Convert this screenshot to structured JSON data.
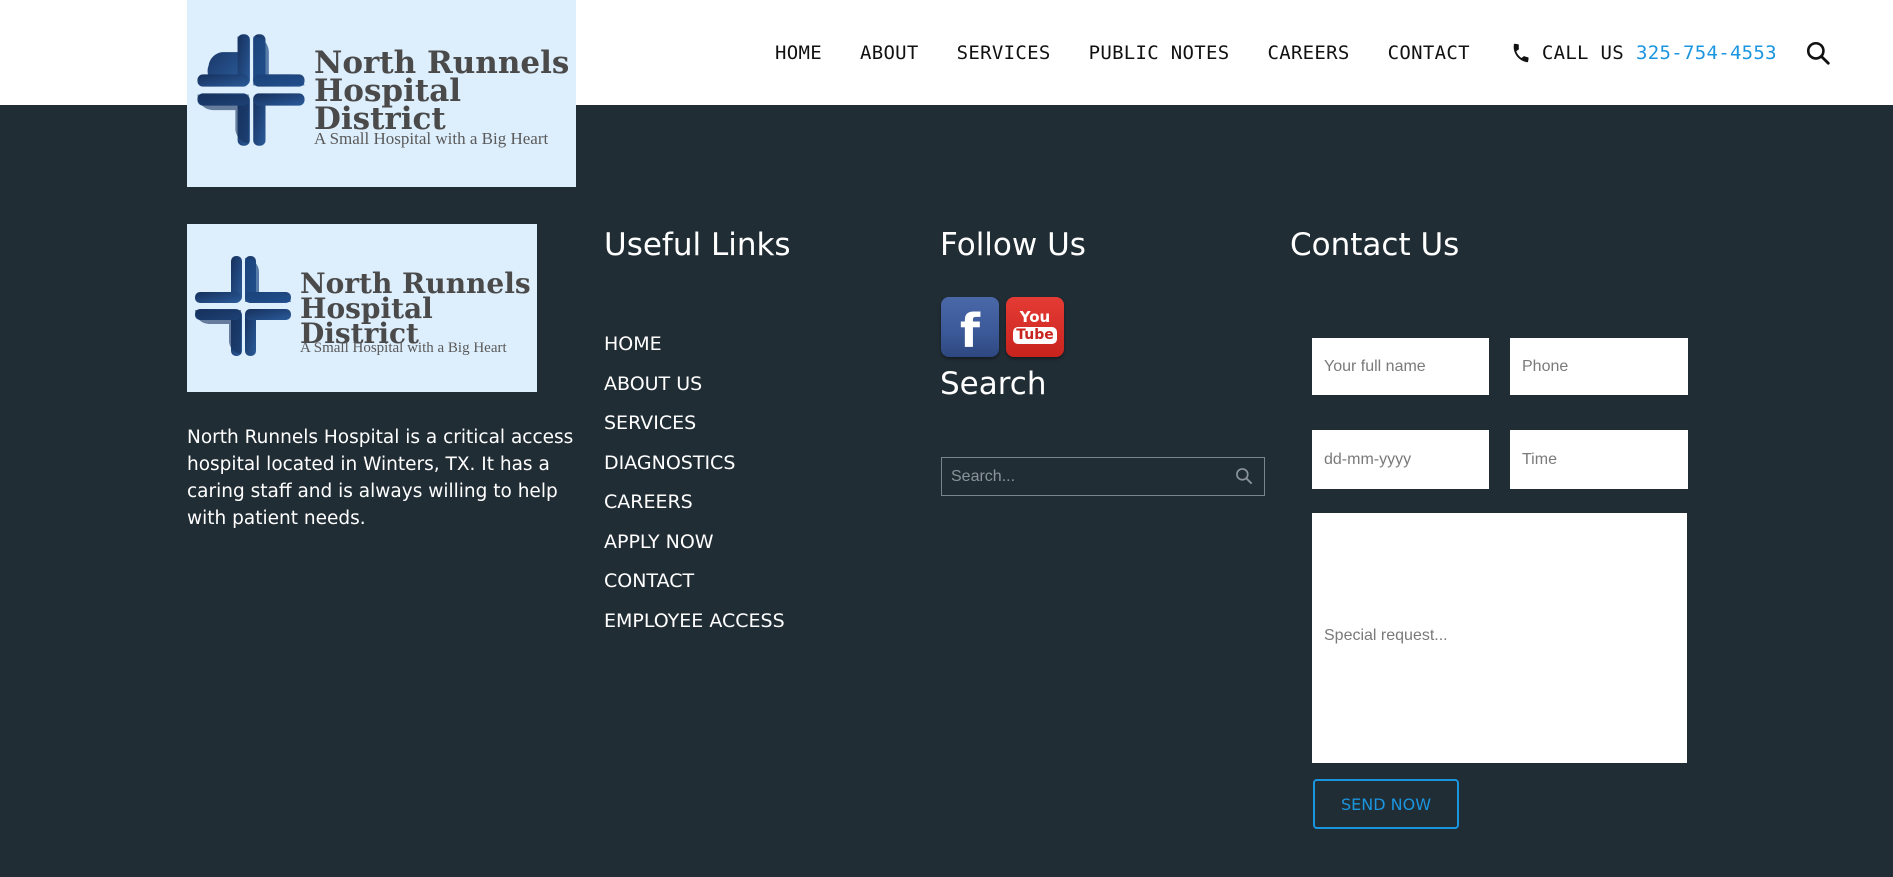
{
  "header": {
    "logo": {
      "name_lines": [
        "North Runnels",
        "Hospital",
        "District"
      ],
      "tagline": "A Small Hospital with a Big Heart"
    },
    "nav": [
      "HOME",
      "ABOUT",
      "SERVICES",
      "PUBLIC NOTES",
      "CAREERS",
      "CONTACT"
    ],
    "call_label": "CALL US",
    "phone": "325-754-4553",
    "icons": {
      "phone": "phone-icon",
      "search": "search-icon"
    }
  },
  "footer": {
    "about": {
      "text": "North Runnels Hospital is a critical access hospital located in Winters, TX. It has a caring staff and is always willing to help with patient needs."
    },
    "useful_links": {
      "title": "Useful Links",
      "items": [
        "HOME",
        "ABOUT US",
        "SERVICES",
        "DIAGNOSTICS",
        "CAREERS",
        "APPLY NOW",
        "CONTACT",
        "EMPLOYEE ACCESS"
      ]
    },
    "follow": {
      "title": "Follow Us",
      "facebook_glyph": "f",
      "youtube_top": "You",
      "youtube_bottom": "Tube"
    },
    "search": {
      "title": "Search",
      "placeholder": "Search..."
    },
    "contact": {
      "title": "Contact Us",
      "name_placeholder": "Your full name",
      "phone_placeholder": "Phone",
      "date_placeholder": "dd-mm-yyyy",
      "time_placeholder": "Time",
      "request_placeholder": "Special request...",
      "submit_label": "SEND NOW"
    }
  },
  "colors": {
    "footer_bg": "#212d35",
    "accent": "#1a95e0",
    "logo_bg": "#ddeefc",
    "logo_cross": "#1d3f73"
  }
}
